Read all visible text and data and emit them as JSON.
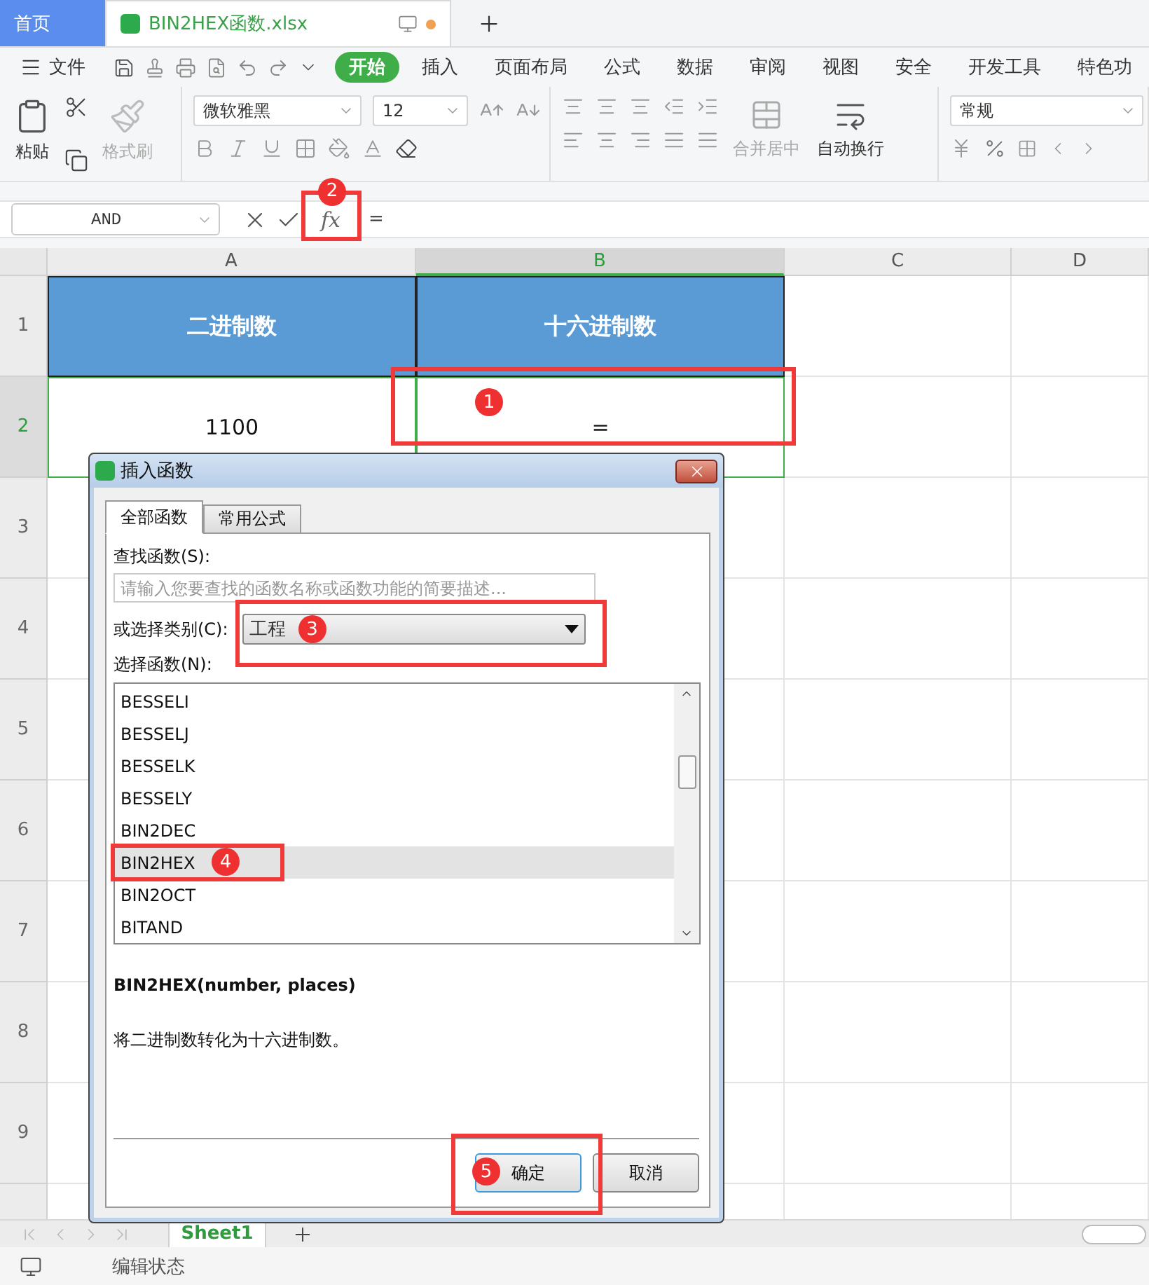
{
  "tabs": [
    {
      "label": "首页",
      "kind": "home",
      "selected": false,
      "unsaved": false
    },
    {
      "label": "BIN2HEX函数.xlsx",
      "kind": "file",
      "selected": true,
      "unsaved": true
    }
  ],
  "menu": {
    "file": "文件",
    "ribbon_tabs": [
      {
        "label": "开始",
        "selected": true
      },
      {
        "label": "插入",
        "selected": false
      },
      {
        "label": "页面布局",
        "selected": false
      },
      {
        "label": "公式",
        "selected": false
      },
      {
        "label": "数据",
        "selected": false
      },
      {
        "label": "审阅",
        "selected": false
      },
      {
        "label": "视图",
        "selected": false
      },
      {
        "label": "安全",
        "selected": false
      },
      {
        "label": "开发工具",
        "selected": false
      },
      {
        "label": "特色功",
        "selected": false
      }
    ]
  },
  "ribbon": {
    "paste": "粘贴",
    "format_painter": {
      "label": "格式刷",
      "disabled": true
    },
    "font": "微软雅黑",
    "size": "12",
    "merge": {
      "label": "合并居中",
      "disabled": true
    },
    "wrap": {
      "label": "自动换行",
      "disabled": false
    },
    "number_format": "常规"
  },
  "formula_bar": {
    "name_box": "AND",
    "fx": "fx",
    "fx_marker": "2",
    "formula": "="
  },
  "sheet": {
    "columns": [
      {
        "label": "A",
        "selected": false
      },
      {
        "label": "B",
        "selected": true
      },
      {
        "label": "C",
        "selected": false
      },
      {
        "label": "D",
        "selected": false
      }
    ],
    "rows": [
      {
        "label": "1",
        "selected": false,
        "cells": [
          {
            "text": "二进制数",
            "kind": "header",
            "selected": false
          },
          {
            "text": "十六进制数",
            "kind": "header",
            "selected": false
          }
        ]
      },
      {
        "label": "2",
        "selected": true,
        "cells": [
          {
            "text": "1100",
            "kind": "value",
            "selected": true
          },
          {
            "text": "=",
            "kind": "value",
            "selected": true,
            "marker": "1"
          }
        ]
      },
      {
        "label": "3",
        "selected": false,
        "cells": []
      },
      {
        "label": "4",
        "selected": false,
        "cells": []
      },
      {
        "label": "5",
        "selected": false,
        "cells": []
      },
      {
        "label": "6",
        "selected": false,
        "cells": []
      },
      {
        "label": "7",
        "selected": false,
        "cells": []
      },
      {
        "label": "8",
        "selected": false,
        "cells": []
      },
      {
        "label": "9",
        "selected": false,
        "cells": []
      }
    ]
  },
  "sheet_tabs": [
    {
      "label": "Sheet1",
      "selected": true
    }
  ],
  "status_bar": {
    "text": "编辑状态"
  },
  "dialog": {
    "title": "插入函数",
    "tabs": [
      {
        "label": "全部函数",
        "selected": true
      },
      {
        "label": "常用公式",
        "selected": false
      }
    ],
    "search_label": "查找函数(S):",
    "search_placeholder": "请输入您要查找的函数名称或函数功能的简要描述...",
    "category_label": "或选择类别(C):",
    "category": "工程",
    "category_marker": "3",
    "list_label": "选择函数(N):",
    "functions": [
      {
        "name": "BESSELI",
        "selected": false
      },
      {
        "name": "BESSELJ",
        "selected": false
      },
      {
        "name": "BESSELK",
        "selected": false
      },
      {
        "name": "BESSELY",
        "selected": false
      },
      {
        "name": "BIN2DEC",
        "selected": false
      },
      {
        "name": "BIN2HEX",
        "selected": true,
        "marker": "4"
      },
      {
        "name": "BIN2OCT",
        "selected": false
      },
      {
        "name": "BITAND",
        "selected": false
      }
    ],
    "signature": "BIN2HEX(number, places)",
    "description": "将二进制数转化为十六进制数。",
    "buttons": [
      {
        "label": "确定",
        "kind": "default",
        "marker": "5"
      },
      {
        "label": "取消",
        "kind": "normal"
      }
    ]
  }
}
